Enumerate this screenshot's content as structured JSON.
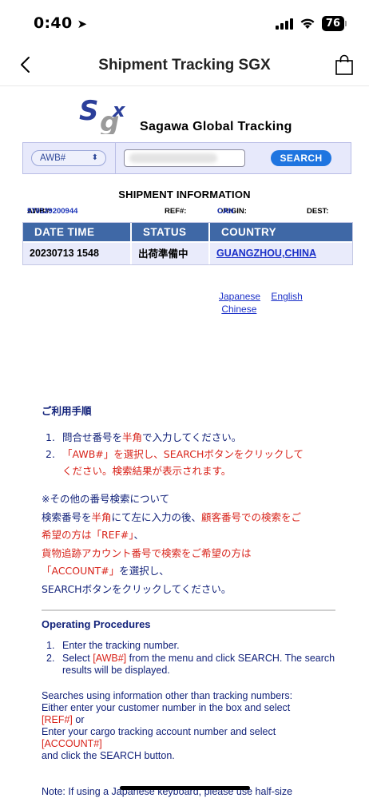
{
  "status_bar": {
    "time": "0:40",
    "battery": "76"
  },
  "nav": {
    "title": "Shipment Tracking SGX"
  },
  "logo": {
    "mark": "Sgx",
    "text": "Sagawa Global Tracking"
  },
  "search": {
    "type_select": "AWB#",
    "input_value": "",
    "button_label": "SEARCH"
  },
  "shipment": {
    "title": "SHIPMENT INFORMATION",
    "awb_label": "AWB#:",
    "awb_value": "570129200944",
    "ref_label": "REF#:",
    "origin_label": "ORIGIN:",
    "origin_value": "CAN",
    "dest_label": "DEST:",
    "columns": [
      "DATE TIME",
      "STATUS",
      "COUNTRY"
    ],
    "rows": [
      {
        "datetime": "20230713 1548",
        "status": "出荷準備中",
        "country": "GUANGZHOU,CHINA"
      }
    ]
  },
  "languages": {
    "japanese": "Japanese",
    "english": "English",
    "chinese": "Chinese"
  },
  "jp_instructions": {
    "heading": "ご利用手順",
    "step1_num": "1.",
    "step1_a": "問合せ番号を",
    "step1_red": "半角",
    "step1_b": "で入力してください。",
    "step2_num": "2.",
    "step2_red": "「AWB#」を選択し、SEARCHボタンをクリックして",
    "step2_b": "ください。検索結果が表示されます。",
    "note_line1": "※その他の番号検索について",
    "note_line2_a": "検索番号を",
    "note_line2_red1": "半角",
    "note_line2_b": "にて左に入力の後、",
    "note_line2_red2": "顧客番号での検索をご",
    "note_line3_red": "希望の方は「REF#」",
    "note_line3_b": "、",
    "note_line4_red": "貨物追跡アカウント番号で検索をご希望の方は",
    "note_line5_red": "「ACCOUNT#」",
    "note_line5_b": "を選択し、",
    "note_line6": "SEARCHボタンをクリックしてください。"
  },
  "en_instructions": {
    "heading": "Operating Procedures",
    "step1_num": "1.",
    "step1": "Enter the tracking number.",
    "step2_num": "2.",
    "step2_a": "Select ",
    "step2_red": "[AWB#]",
    "step2_b": " from the menu and click SEARCH. The search results will be displayed.",
    "note_line1": "Searches using information other than tracking numbers:",
    "note_line2": "Either enter your customer number in the box and select",
    "note_ref": "[REF#]",
    "note_or": " or",
    "note_line4": "Enter your cargo tracking account number and select",
    "note_account": "[ACCOUNT#]",
    "note_line6": "and click the SEARCH button.",
    "bottom_note": "Note: If using a Japanese keyboard, please use half-size"
  }
}
